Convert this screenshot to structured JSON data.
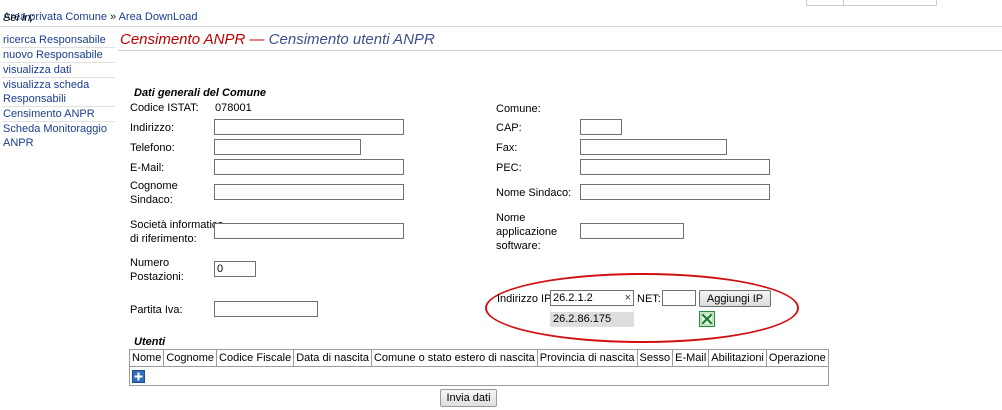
{
  "breadcrumb": {
    "prefix": "Sei in:",
    "link1": "Area privata Comune",
    "separator": "»",
    "link2": "Area DownLoad"
  },
  "sidebar": {
    "items": [
      {
        "label": "ricerca Responsabile"
      },
      {
        "label": "nuovo Responsabile"
      },
      {
        "label": "visualizza dati"
      },
      {
        "label": "visualizza scheda Responsabili"
      },
      {
        "label": "Censimento ANPR"
      },
      {
        "label": "Scheda Monitoraggio ANPR"
      }
    ]
  },
  "page": {
    "title_main": "Censimento ANPR",
    "title_dash": "—",
    "title_sub": "Censimento utenti ANPR"
  },
  "form": {
    "section_title": "Dati generali del Comune",
    "codice_istat_label": "Codice ISTAT:",
    "codice_istat_value": "078001",
    "indirizzo_label": "Indirizzo:",
    "indirizzo_value": "",
    "telefono_label": "Telefono:",
    "telefono_value": "",
    "email_label": "E-Mail:",
    "email_value": "",
    "cognome_sindaco_label_1": "Cognome",
    "cognome_sindaco_label_2": "Sindaco:",
    "cognome_sindaco_value": "",
    "societa_label_1": "Società informatica",
    "societa_label_2": "di riferimento:",
    "societa_value": "",
    "numero_postazioni_label_1": "Numero",
    "numero_postazioni_label_2": "Postazioni:",
    "numero_postazioni_value": "0",
    "partita_iva_label": "Partita Iva:",
    "partita_iva_value": "",
    "comune_label": "Comune:",
    "comune_value": "",
    "cap_label": "CAP:",
    "cap_value": "",
    "fax_label": "Fax:",
    "fax_value": "",
    "pec_label": "PEC:",
    "pec_value": "",
    "nome_sindaco_label": "Nome Sindaco:",
    "nome_sindaco_value": "",
    "nome_app_label_1": "Nome",
    "nome_app_label_2": "applicazione",
    "nome_app_label_3": "software:",
    "nome_app_value": ""
  },
  "ip": {
    "label": "Indirizzo IP:",
    "value": "26.2.1.2",
    "clear_glyph": "×",
    "net_label": "NET:",
    "net_value": "",
    "add_button": "Aggiungi IP",
    "list_items": [
      "26.2.86.175"
    ],
    "highlight_color": "#d01010"
  },
  "users": {
    "title": "Utenti",
    "columns": [
      "Nome",
      "Cognome",
      "Codice Fiscale",
      "Data di nascita",
      "Comune o stato estero di nascita",
      "Provincia di nascita",
      "Sesso",
      "E-Mail",
      "Abilitazioni",
      "Operazione"
    ],
    "add_icon": "plus-icon"
  },
  "submit_button": "Invia dati",
  "colors": {
    "title_red": "#c00000",
    "title_blue": "#3f4f8a",
    "link_blue": "#1a3d8f"
  }
}
